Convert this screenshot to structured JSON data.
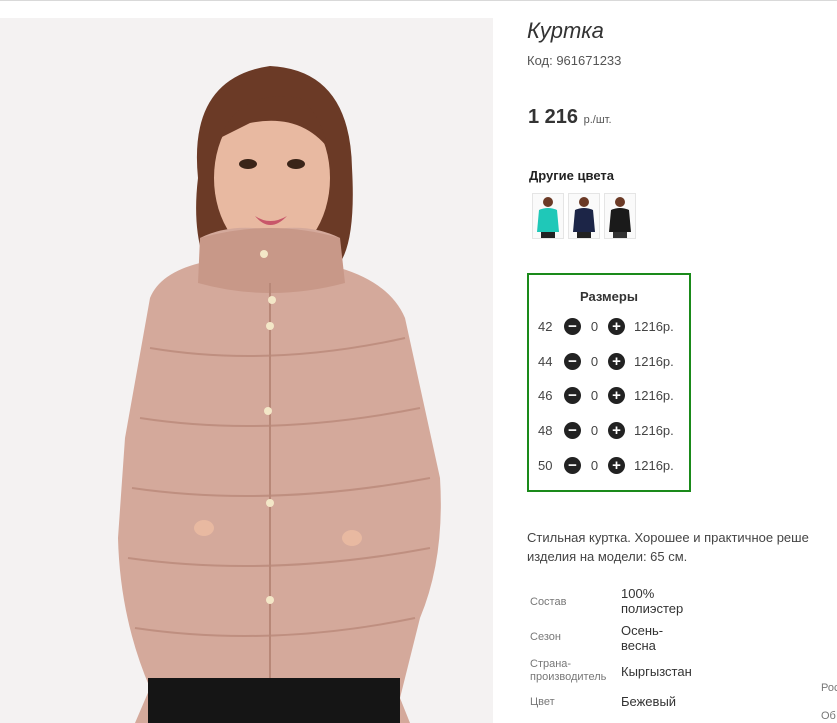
{
  "product": {
    "title": "Куртка",
    "code": "Код: 961671233",
    "price": "1 216",
    "price_unit": "р./шт."
  },
  "colors": {
    "title": "Другие цвета",
    "swatches": [
      {
        "icon": "teal-jacket-thumbnail",
        "color": "#1fc8b8"
      },
      {
        "icon": "navy-jacket-thumbnail",
        "color": "#1c2547"
      },
      {
        "icon": "black-jacket-thumbnail",
        "color": "#1a1a1a"
      }
    ]
  },
  "sizes": {
    "title": "Размеры",
    "rows": [
      {
        "size": "42",
        "qty": "0",
        "price": "1216р."
      },
      {
        "size": "44",
        "qty": "0",
        "price": "1216р."
      },
      {
        "size": "46",
        "qty": "0",
        "price": "1216р."
      },
      {
        "size": "48",
        "qty": "0",
        "price": "1216р."
      },
      {
        "size": "50",
        "qty": "0",
        "price": "1216р."
      }
    ],
    "minus_icon": "minus-circle-icon",
    "plus_icon": "plus-circle-icon"
  },
  "description": {
    "line1": "Стильная куртка. Хорошее и практичное реше",
    "line2": "изделия на модели: 65 см."
  },
  "attributes": [
    {
      "label": "Состав",
      "value_line1": "100%",
      "value_line2": "полиэстер"
    },
    {
      "label": "Сезон",
      "value_line1": "Осень-",
      "value_line2": "весна"
    },
    {
      "label_line1": "Страна-",
      "label_line2": "производитель",
      "value_line1": "Кыргызстан"
    },
    {
      "label": "Цвет",
      "value_line1": "Бежевый"
    }
  ],
  "edge": {
    "text1": "Рос",
    "text2": "Об"
  },
  "accent_color": "#1a8a1a",
  "button_color": "#a7e53b"
}
